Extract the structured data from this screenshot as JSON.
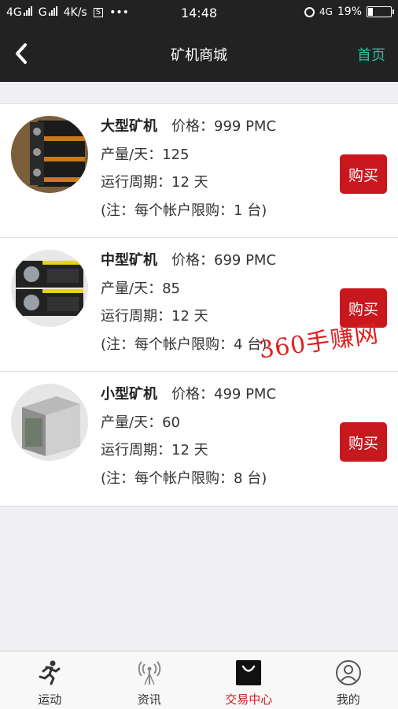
{
  "status_bar": {
    "net1": "4G",
    "net2": "G",
    "speed": "4K/s",
    "notify_icon": "S",
    "more": "•••",
    "time": "14:48",
    "net3": "4G",
    "battery_percent": "19%",
    "battery_level": 0.19
  },
  "navbar": {
    "title": "矿机商城",
    "home_label": "首页",
    "back_icon": "chevron-left-icon"
  },
  "products": [
    {
      "name": "大型矿机",
      "price_label": "价格：",
      "price": "999 PMC",
      "output": "产量/天：125",
      "cycle": "运行周期：12 天",
      "note": "(注：每个帐户限购：1 台)",
      "buy_label": "购买"
    },
    {
      "name": "中型矿机",
      "price_label": "价格：",
      "price": "699 PMC",
      "output": "产量/天：85",
      "cycle": "运行周期：12 天",
      "note": "(注：每个帐户限购：4 台)",
      "buy_label": "购买"
    },
    {
      "name": "小型矿机",
      "price_label": "价格：",
      "price": "499 PMC",
      "output": "产量/天：60",
      "cycle": "运行周期：12 天",
      "note": "(注：每个帐户限购：8 台)",
      "buy_label": "购买"
    }
  ],
  "watermark": "360手赚网",
  "tabs": [
    {
      "label": "运动",
      "icon": "running-icon",
      "active": false
    },
    {
      "label": "资讯",
      "icon": "antenna-icon",
      "active": false
    },
    {
      "label": "交易中心",
      "icon": "shopping-bag-icon",
      "active": true
    },
    {
      "label": "我的",
      "icon": "user-icon",
      "active": false
    }
  ],
  "colors": {
    "header_bg": "#222222",
    "accent_green": "#28c2a0",
    "buy_red": "#c8181e",
    "active_tab_red": "#d41a1a"
  }
}
